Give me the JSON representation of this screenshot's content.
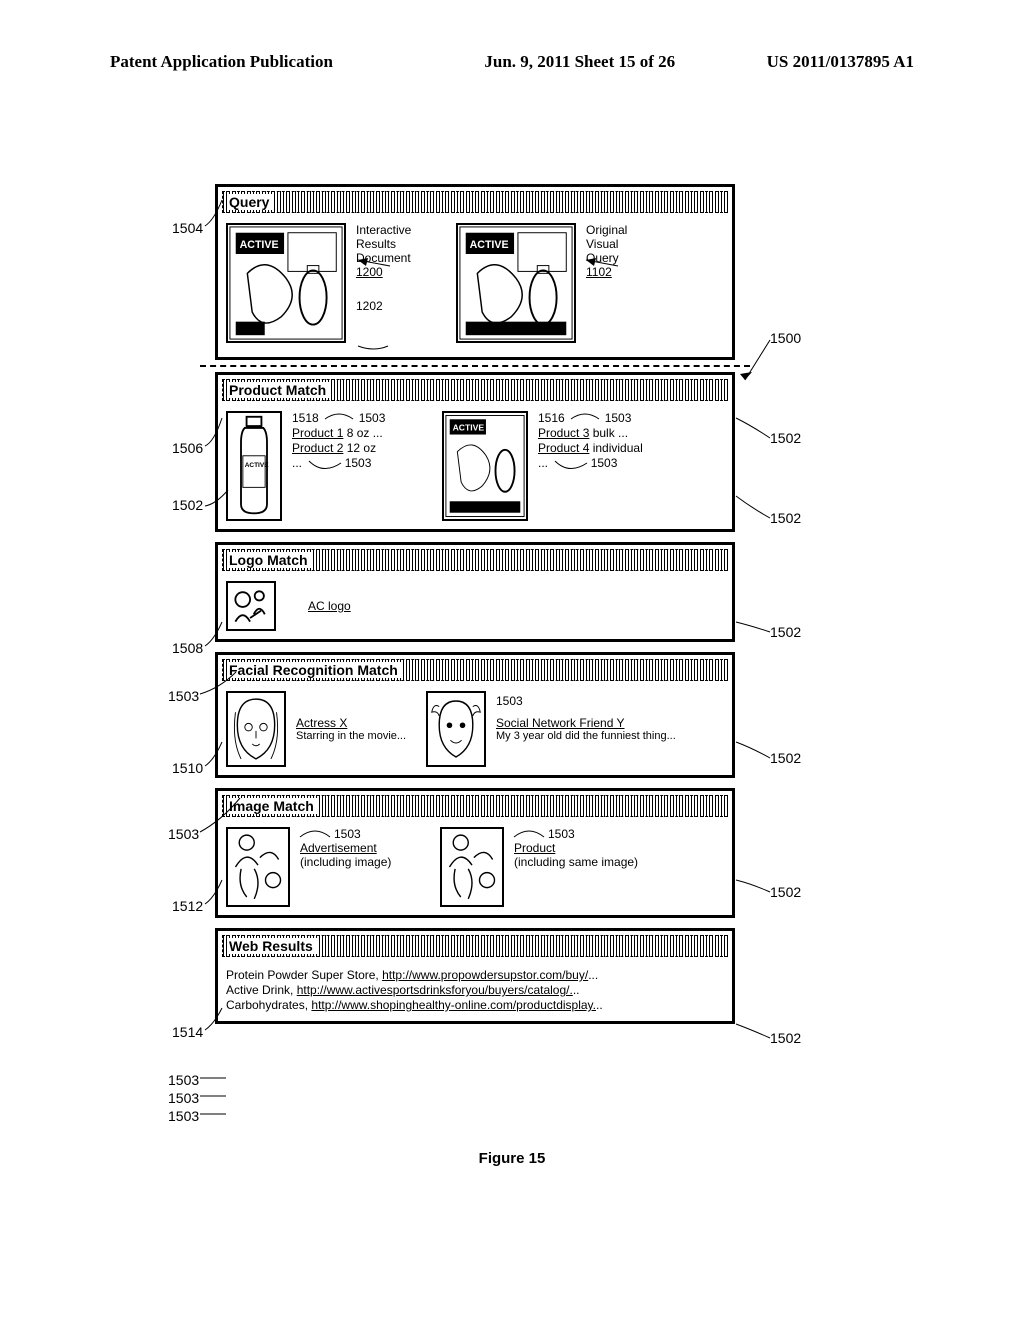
{
  "header": {
    "left": "Patent Application Publication",
    "center": "Jun. 9, 2011   Sheet 15 of 26",
    "right": "US 2011/0137895 A1"
  },
  "refs": {
    "r1504": "1504",
    "r1506": "1506",
    "r1502a": "1502",
    "r1508": "1508",
    "r1503a": "1503",
    "r1510": "1510",
    "r1503b": "1503",
    "r1512": "1512",
    "r1514": "1514",
    "r1503c": "1503",
    "r1503d": "1503",
    "r1503e": "1503",
    "r1500": "1500",
    "r1502r1": "1502",
    "r1502r1b": "1502",
    "r1502r2": "1502",
    "r1502r3": "1502",
    "r1502r4": "1502",
    "r1502r5": "1502"
  },
  "sections": {
    "query": {
      "title": "Query",
      "left_label1": "Interactive",
      "left_label2": "Results",
      "left_label3": "Document",
      "left_label4": "1200",
      "left_ref": "1202",
      "right_label1": "Original",
      "right_label2": "Visual",
      "right_label3": "Query",
      "right_label4": "1102"
    },
    "product": {
      "title": "Product Match",
      "r1518": "1518",
      "r1503p1": "1503",
      "p1": "Product 1",
      "p1s": " 8 oz ...",
      "p2": "Product 2",
      "p2s": " 12 oz",
      "dots1": "...",
      "r1503p2": "1503",
      "r1516": "1516",
      "r1503p3": "1503",
      "p3": "Product 3",
      "p3s": " bulk ...",
      "p4": "Product 4",
      "p4s": " individual",
      "dots2": "...",
      "r1503p4": "1503"
    },
    "logo": {
      "title": "Logo Match",
      "link": "AC logo"
    },
    "facial": {
      "title": "Facial Recognition Match",
      "a_link": "Actress X",
      "a_sub": "Starring in the movie...",
      "r1503f": "1503",
      "b_link": "Social Network Friend Y",
      "b_sub": "My 3 year old did the funniest thing..."
    },
    "image": {
      "title": "Image Match",
      "r1503i1": "1503",
      "a_link": "Advertisement",
      "a_sub": "(including image)",
      "r1503i2": "1503",
      "b_link": "Product",
      "b_sub": "(including same image)"
    },
    "web": {
      "title": "Web Results",
      "r1": "Protein Powder Super Store, ",
      "r1u": "http://www.propowdersupstor.com/buy/",
      "r1e": "...",
      "r2": "Active Drink, ",
      "r2u": "http://www.activesportsdrinksforyou/buyers/catalog/.",
      "r2e": "..",
      "r3": "Carbohydrates, ",
      "r3u": "http://www.shopinghealthy-online.com/productdisplay.",
      "r3e": ".."
    }
  },
  "caption": "Figure 15"
}
